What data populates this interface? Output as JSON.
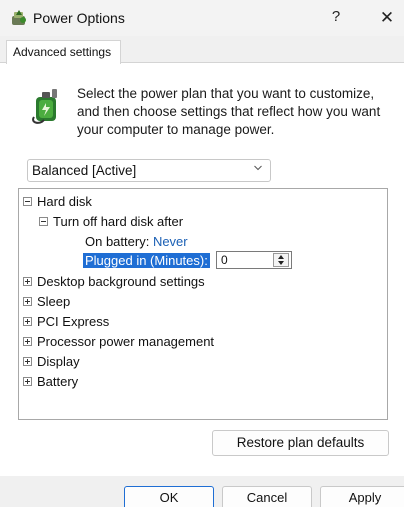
{
  "window": {
    "title": "Power Options",
    "help_label": "?",
    "close_label": "✕"
  },
  "tab": {
    "label": "Advanced settings"
  },
  "description": "Select the power plan that you want to customize, and then choose settings that reflect how you want your computer to manage power.",
  "plan_select": {
    "value": "Balanced [Active]"
  },
  "tree": {
    "hard_disk": "Hard disk",
    "turn_off": "Turn off hard disk after",
    "on_battery_label": "On battery:",
    "on_battery_value": "Never",
    "plugged_in_label": "Plugged in (Minutes):",
    "plugged_in_value": "0",
    "collapsed_items": [
      "Desktop background settings",
      "Sleep",
      "PCI Express",
      "Processor power management",
      "Display",
      "Battery"
    ]
  },
  "buttons": {
    "restore": "Restore plan defaults",
    "ok": "OK",
    "cancel": "Cancel",
    "apply": "Apply"
  },
  "colors": {
    "highlight": "#1f6ed4",
    "link": "#1a5fb4"
  }
}
